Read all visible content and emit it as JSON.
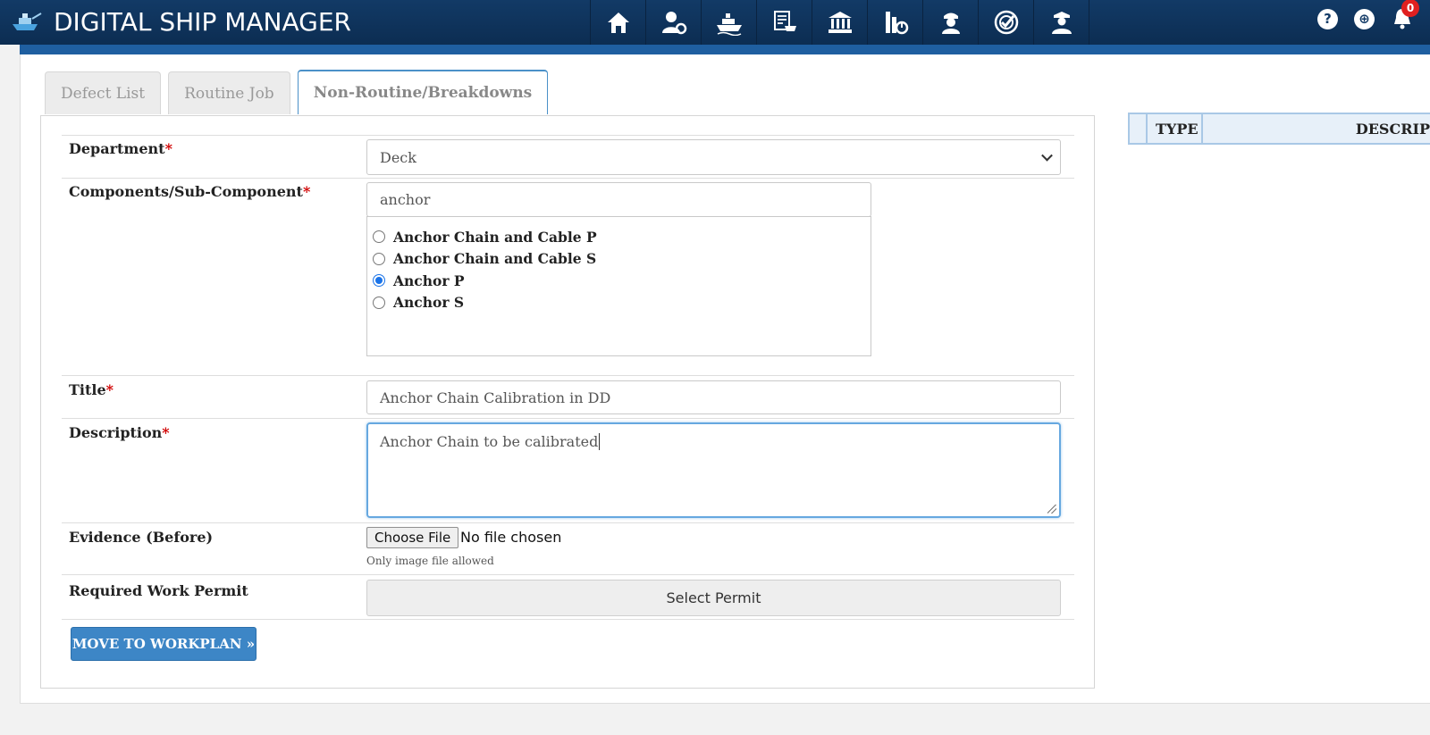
{
  "app": {
    "title": "DIGITAL SHIP MANAGER"
  },
  "nav": {
    "icons": [
      "home-icon",
      "user-settings-icon",
      "ship-icon",
      "purchase-cart-icon",
      "bank-icon",
      "building-chart-icon",
      "crew-icon",
      "target-check-icon",
      "captain-icon"
    ]
  },
  "header_right": {
    "help_glyph": "?",
    "download_glyph": "⊕",
    "notification_count": "0"
  },
  "tabs": [
    {
      "label": "Defect List",
      "active": false
    },
    {
      "label": "Routine Job",
      "active": false
    },
    {
      "label": "Non-Routine/Breakdowns",
      "active": true
    }
  ],
  "form": {
    "department": {
      "label": "Department",
      "required": "*",
      "value": "Deck"
    },
    "component": {
      "label": "Components/Sub-Component",
      "required": "*",
      "search_value": "anchor",
      "options": [
        {
          "label": "Anchor Chain and Cable P",
          "checked": false
        },
        {
          "label": "Anchor Chain and Cable S",
          "checked": false
        },
        {
          "label": "Anchor P",
          "checked": true
        },
        {
          "label": "Anchor S",
          "checked": false
        }
      ]
    },
    "title": {
      "label": "Title",
      "required": "*",
      "value": "Anchor Chain Calibration in DD"
    },
    "description": {
      "label": "Description",
      "required": "*",
      "value": "Anchor Chain to be calibrated"
    },
    "evidence": {
      "label": "Evidence (Before)",
      "button_label": "Choose File",
      "status": "No file chosen",
      "hint": "Only image file allowed"
    },
    "permit": {
      "label": "Required Work Permit",
      "button_label": "Select Permit"
    },
    "submit_label": "MOVE TO WORKPLAN »"
  },
  "right_table": {
    "columns": [
      "TYPE",
      "DESCRIP"
    ]
  },
  "colors": {
    "topbar": "#123a66",
    "accent": "#3d86c6",
    "required": "#d00000",
    "badge": "#e02020"
  }
}
